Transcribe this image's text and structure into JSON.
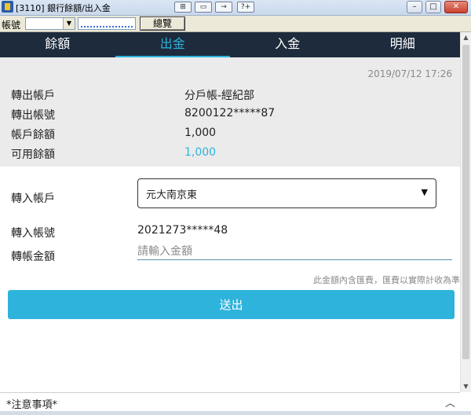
{
  "window": {
    "title": "[3110] 銀行餘額/出入金"
  },
  "titlebar_tools": [
    "⊞",
    "▭",
    "→",
    "?+"
  ],
  "window_buttons": {
    "minimize": "–",
    "maximize": "□",
    "close": "✕"
  },
  "account_bar": {
    "label": "帳號",
    "overview_button": "總覽"
  },
  "tabs": [
    {
      "label": "餘額"
    },
    {
      "label": "出金"
    },
    {
      "label": "入金"
    },
    {
      "label": "明細"
    }
  ],
  "active_tab": "出金",
  "info": {
    "timestamp": "2019/07/12 17:26",
    "rows": [
      {
        "label": "轉出帳戶",
        "value": "分戶帳-經紀部"
      },
      {
        "label": "轉出帳號",
        "value": "8200122*****87"
      },
      {
        "label": "帳戶餘額",
        "value": "1,000"
      },
      {
        "label": "可用餘額",
        "value": "1,000"
      }
    ],
    "available_color": "#2db3dc"
  },
  "form": {
    "transfer_in_account_label": "轉入帳戶",
    "transfer_in_account_value": "元大南京東",
    "transfer_in_number_label": "轉入帳號",
    "transfer_in_number_value": "2021273*****48",
    "amount_label": "轉帳金額",
    "amount_placeholder": "請輸入金額",
    "note": "此金額內含匯費，匯費以實際計收為準",
    "submit_label": "送出"
  },
  "footer": {
    "label": "*注意事項*"
  },
  "colors": {
    "accent": "#2db3dc",
    "tab_bar": "#1d2b3d",
    "info_bg": "#ebebeb"
  }
}
